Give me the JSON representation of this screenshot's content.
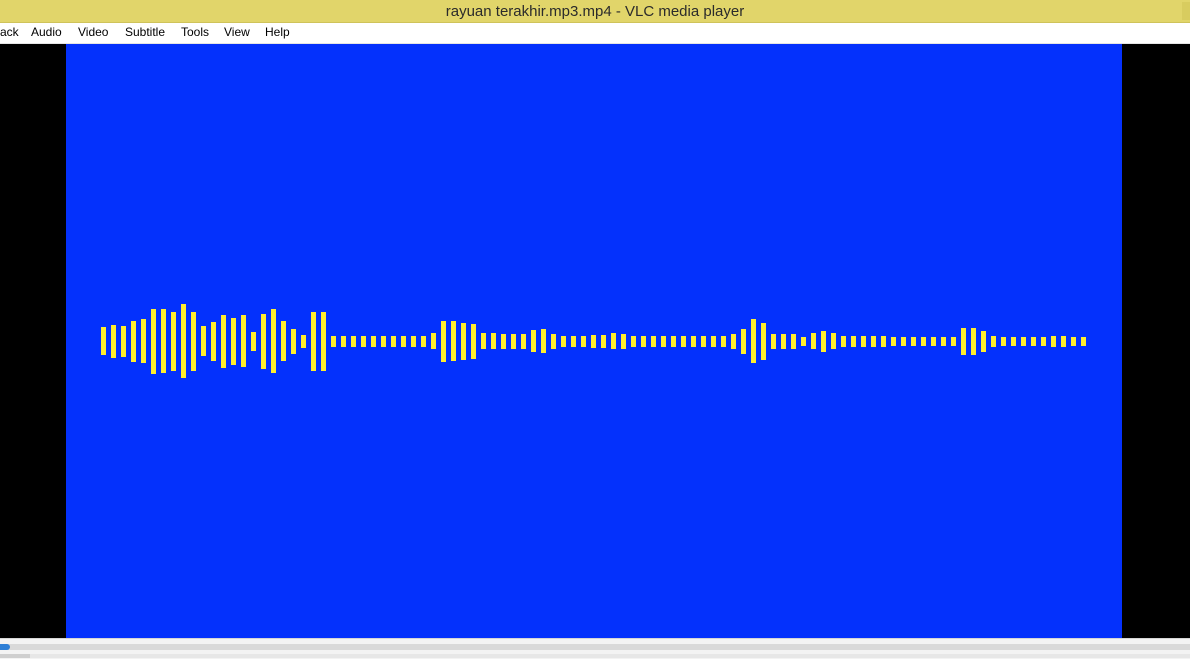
{
  "window": {
    "title": "rayuan terakhir.mp3.mp4 - VLC media player"
  },
  "menu": [
    "ack",
    "Audio",
    "Video",
    "Subtitle",
    "Tools",
    "View",
    "Help"
  ],
  "video": {
    "background_color": "#0431fc",
    "waveform_color": "#ffee2e",
    "waveform_levels": [
      0.38,
      0.44,
      0.42,
      0.56,
      0.6,
      0.88,
      0.86,
      0.8,
      1.0,
      0.8,
      0.4,
      0.53,
      0.72,
      0.64,
      0.7,
      0.26,
      0.74,
      0.86,
      0.54,
      0.34,
      0.18,
      0.8,
      0.8,
      0.15,
      0.15,
      0.15,
      0.15,
      0.15,
      0.15,
      0.15,
      0.15,
      0.15,
      0.15,
      0.22,
      0.56,
      0.54,
      0.5,
      0.47,
      0.22,
      0.22,
      0.2,
      0.2,
      0.2,
      0.3,
      0.32,
      0.2,
      0.15,
      0.15,
      0.15,
      0.18,
      0.18,
      0.22,
      0.2,
      0.15,
      0.15,
      0.15,
      0.15,
      0.15,
      0.15,
      0.15,
      0.15,
      0.15,
      0.15,
      0.2,
      0.34,
      0.6,
      0.5,
      0.2,
      0.2,
      0.2,
      0.12,
      0.22,
      0.28,
      0.22,
      0.15,
      0.15,
      0.15,
      0.15,
      0.15,
      0.12,
      0.12,
      0.12,
      0.12,
      0.12,
      0.12,
      0.12,
      0.36,
      0.36,
      0.28,
      0.15,
      0.12,
      0.12,
      0.12,
      0.12,
      0.12,
      0.15,
      0.15,
      0.12,
      0.12
    ]
  },
  "controls": {
    "seek_progress": 0.008
  }
}
